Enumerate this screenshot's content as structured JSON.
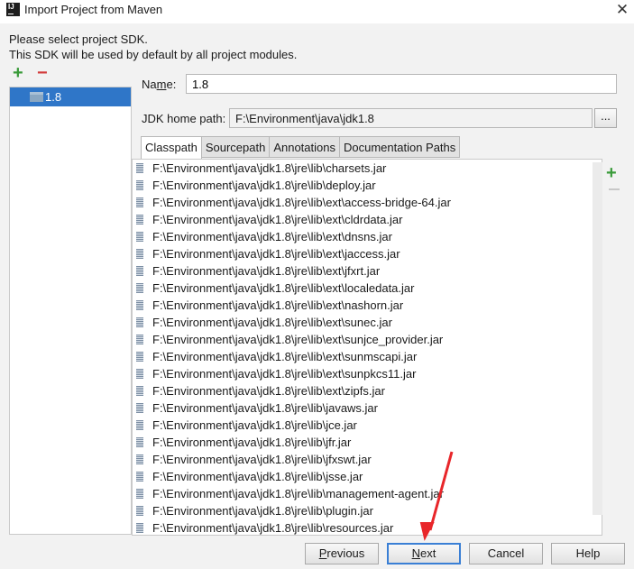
{
  "window": {
    "title": "Import Project from Maven",
    "icon_text": "IJ",
    "close_glyph": "✕"
  },
  "description": {
    "line1": "Please select project SDK.",
    "line2": "This SDK will be used by default by all project modules."
  },
  "sdk_panel": {
    "add_glyph": "+",
    "remove_glyph": "−",
    "items": [
      {
        "label": "1.8",
        "selected": true,
        "icon": "folder-icon"
      }
    ]
  },
  "fields": {
    "name_label_pre": "Na",
    "name_label_mnemonic": "m",
    "name_label_post": "e:",
    "name_value": "1.8",
    "jdk_home_label": "JDK home path:",
    "jdk_home_value": "F:\\Environment\\java\\jdk1.8",
    "browse_label": "..."
  },
  "tabs": [
    {
      "label": "Classpath",
      "active": true
    },
    {
      "label": "Sourcepath",
      "active": false
    },
    {
      "label": "Annotations",
      "active": false
    },
    {
      "label": "Documentation Paths",
      "active": false
    }
  ],
  "classpath": [
    "F:\\Environment\\java\\jdk1.8\\jre\\lib\\charsets.jar",
    "F:\\Environment\\java\\jdk1.8\\jre\\lib\\deploy.jar",
    "F:\\Environment\\java\\jdk1.8\\jre\\lib\\ext\\access-bridge-64.jar",
    "F:\\Environment\\java\\jdk1.8\\jre\\lib\\ext\\cldrdata.jar",
    "F:\\Environment\\java\\jdk1.8\\jre\\lib\\ext\\dnsns.jar",
    "F:\\Environment\\java\\jdk1.8\\jre\\lib\\ext\\jaccess.jar",
    "F:\\Environment\\java\\jdk1.8\\jre\\lib\\ext\\jfxrt.jar",
    "F:\\Environment\\java\\jdk1.8\\jre\\lib\\ext\\localedata.jar",
    "F:\\Environment\\java\\jdk1.8\\jre\\lib\\ext\\nashorn.jar",
    "F:\\Environment\\java\\jdk1.8\\jre\\lib\\ext\\sunec.jar",
    "F:\\Environment\\java\\jdk1.8\\jre\\lib\\ext\\sunjce_provider.jar",
    "F:\\Environment\\java\\jdk1.8\\jre\\lib\\ext\\sunmscapi.jar",
    "F:\\Environment\\java\\jdk1.8\\jre\\lib\\ext\\sunpkcs11.jar",
    "F:\\Environment\\java\\jdk1.8\\jre\\lib\\ext\\zipfs.jar",
    "F:\\Environment\\java\\jdk1.8\\jre\\lib\\javaws.jar",
    "F:\\Environment\\java\\jdk1.8\\jre\\lib\\jce.jar",
    "F:\\Environment\\java\\jdk1.8\\jre\\lib\\jfr.jar",
    "F:\\Environment\\java\\jdk1.8\\jre\\lib\\jfxswt.jar",
    "F:\\Environment\\java\\jdk1.8\\jre\\lib\\jsse.jar",
    "F:\\Environment\\java\\jdk1.8\\jre\\lib\\management-agent.jar",
    "F:\\Environment\\java\\jdk1.8\\jre\\lib\\plugin.jar",
    "F:\\Environment\\java\\jdk1.8\\jre\\lib\\resources.jar"
  ],
  "classpath_tools": {
    "add_glyph": "+"
  },
  "footer": {
    "previous": {
      "pre": "",
      "mnemonic": "P",
      "post": "revious"
    },
    "next": {
      "pre": "",
      "mnemonic": "N",
      "post": "ext"
    },
    "cancel": "Cancel",
    "help": "Help"
  },
  "colors": {
    "selection": "#2f76c8",
    "add": "#3a9b3a",
    "remove": "#d23b3b",
    "annotation_arrow": "#e8262a",
    "default_button_border": "#3a7fd5"
  }
}
